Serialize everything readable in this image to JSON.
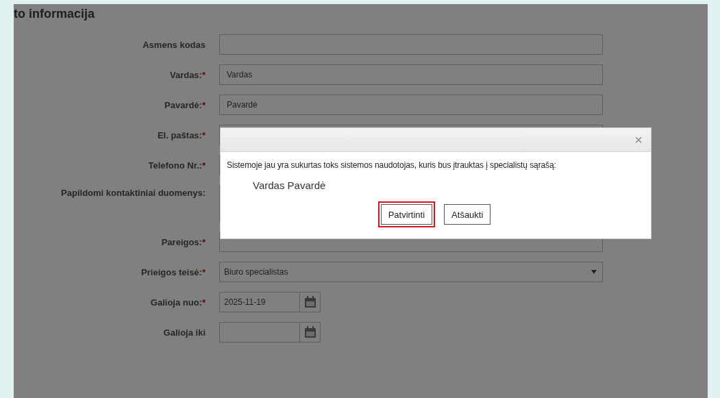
{
  "section_title": "to informacija",
  "fields": [
    {
      "label": "Asmens kodas",
      "kind": "text"
    },
    {
      "label": "Vardas:",
      "required_mark": "*",
      "kind": "text",
      "value": "Vardas"
    },
    {
      "label": "Pavardė:",
      "required_mark": "*",
      "kind": "text",
      "value": "Pavardė"
    },
    {
      "label": "El. paštas:",
      "required_mark": "*",
      "kind": "text"
    },
    {
      "label": "Telefono Nr.:",
      "required_mark": "*",
      "kind": "text"
    },
    {
      "label": "Papildomi kontaktiniai duomenys:",
      "kind": "textarea"
    },
    {
      "label": "Pareigos:",
      "required_mark": "*",
      "kind": "text"
    },
    {
      "label": "Prieigos teisė:",
      "required_mark": "*",
      "kind": "select",
      "value": "Biuro specialistas"
    },
    {
      "label": "Galioja nuo:",
      "required_mark": "*",
      "kind": "date",
      "value": "2025-11-19"
    },
    {
      "label": "Galioja iki",
      "kind": "date"
    }
  ],
  "dialog": {
    "close": "×",
    "message": "Sistemoje jau yra sukurtas toks sistemos naudotojas, kuris bus įtrauktas į specialistų sąrašą:",
    "person": "Vardas Pavardė",
    "buttons": [
      {
        "label": "Patvirtinti",
        "highlighted": true
      },
      {
        "label": "Atšaukti",
        "highlighted": false
      }
    ]
  }
}
